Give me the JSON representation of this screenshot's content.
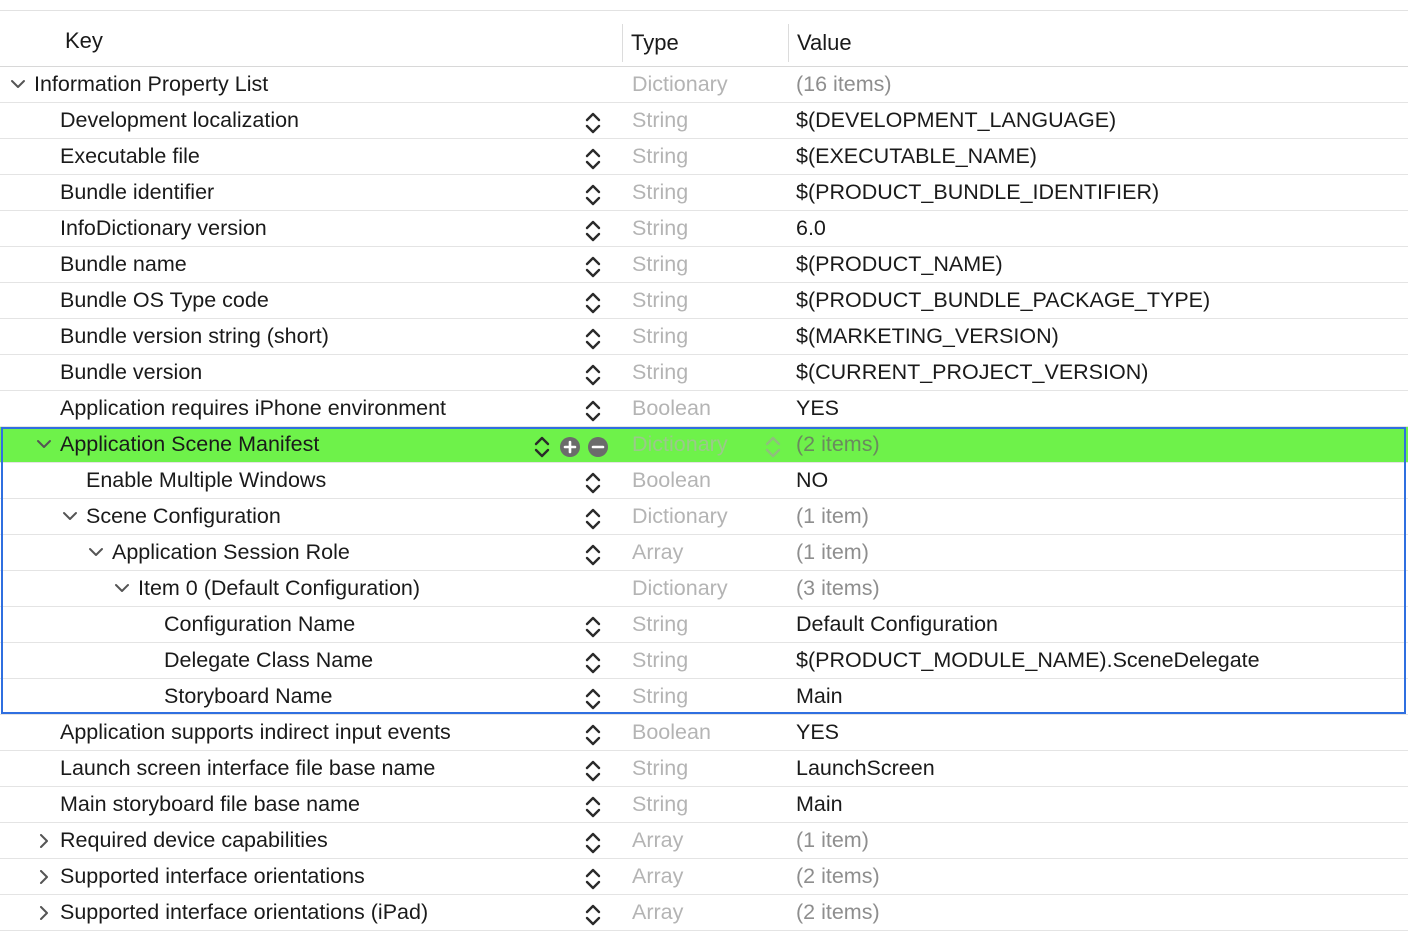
{
  "header": {
    "key": "Key",
    "type": "Type",
    "value": "Value"
  },
  "rows": [
    {
      "key": "Information Property List",
      "type": "Dictionary",
      "value": "(16 items)",
      "indent": 0,
      "disclosure": "open",
      "stepper": false,
      "value_muted": true
    },
    {
      "key": "Development localization",
      "type": "String",
      "value": "$(DEVELOPMENT_LANGUAGE)",
      "indent": 1,
      "disclosure": "none",
      "stepper": true
    },
    {
      "key": "Executable file",
      "type": "String",
      "value": "$(EXECUTABLE_NAME)",
      "indent": 1,
      "disclosure": "none",
      "stepper": true
    },
    {
      "key": "Bundle identifier",
      "type": "String",
      "value": "$(PRODUCT_BUNDLE_IDENTIFIER)",
      "indent": 1,
      "disclosure": "none",
      "stepper": true
    },
    {
      "key": "InfoDictionary version",
      "type": "String",
      "value": "6.0",
      "indent": 1,
      "disclosure": "none",
      "stepper": true
    },
    {
      "key": "Bundle name",
      "type": "String",
      "value": "$(PRODUCT_NAME)",
      "indent": 1,
      "disclosure": "none",
      "stepper": true
    },
    {
      "key": "Bundle OS Type code",
      "type": "String",
      "value": "$(PRODUCT_BUNDLE_PACKAGE_TYPE)",
      "indent": 1,
      "disclosure": "none",
      "stepper": true
    },
    {
      "key": "Bundle version string (short)",
      "type": "String",
      "value": "$(MARKETING_VERSION)",
      "indent": 1,
      "disclosure": "none",
      "stepper": true
    },
    {
      "key": "Bundle version",
      "type": "String",
      "value": "$(CURRENT_PROJECT_VERSION)",
      "indent": 1,
      "disclosure": "none",
      "stepper": true
    },
    {
      "key": "Application requires iPhone environment",
      "type": "Boolean",
      "value": "YES",
      "indent": 1,
      "disclosure": "none",
      "stepper": true
    },
    {
      "key": "Application Scene Manifest",
      "type": "Dictionary",
      "value": "(2 items)",
      "indent": 1,
      "disclosure": "open",
      "stepper": true,
      "selected": true,
      "value_muted": true
    },
    {
      "key": "Enable Multiple Windows",
      "type": "Boolean",
      "value": "NO",
      "indent": 2,
      "disclosure": "none",
      "stepper": true
    },
    {
      "key": "Scene Configuration",
      "type": "Dictionary",
      "value": "(1 item)",
      "indent": 2,
      "disclosure": "open",
      "stepper": true,
      "value_muted": true
    },
    {
      "key": "Application Session Role",
      "type": "Array",
      "value": "(1 item)",
      "indent": 3,
      "disclosure": "open",
      "stepper": true,
      "value_muted": true
    },
    {
      "key": "Item 0 (Default Configuration)",
      "type": "Dictionary",
      "value": "(3 items)",
      "indent": 4,
      "disclosure": "open",
      "stepper": false,
      "value_muted": true
    },
    {
      "key": "Configuration Name",
      "type": "String",
      "value": "Default Configuration",
      "indent": 5,
      "disclosure": "none",
      "stepper": true
    },
    {
      "key": "Delegate Class Name",
      "type": "String",
      "value": "$(PRODUCT_MODULE_NAME).SceneDelegate",
      "indent": 5,
      "disclosure": "none",
      "stepper": true
    },
    {
      "key": "Storyboard Name",
      "type": "String",
      "value": "Main",
      "indent": 5,
      "disclosure": "none",
      "stepper": true
    },
    {
      "key": "Application supports indirect input events",
      "type": "Boolean",
      "value": "YES",
      "indent": 1,
      "disclosure": "none",
      "stepper": true
    },
    {
      "key": "Launch screen interface file base name",
      "type": "String",
      "value": "LaunchScreen",
      "indent": 1,
      "disclosure": "none",
      "stepper": true
    },
    {
      "key": "Main storyboard file base name",
      "type": "String",
      "value": "Main",
      "indent": 1,
      "disclosure": "none",
      "stepper": true
    },
    {
      "key": "Required device capabilities",
      "type": "Array",
      "value": "(1 item)",
      "indent": 1,
      "disclosure": "closed",
      "stepper": true,
      "value_muted": true
    },
    {
      "key": "Supported interface orientations",
      "type": "Array",
      "value": "(2 items)",
      "indent": 1,
      "disclosure": "closed",
      "stepper": true,
      "value_muted": true
    },
    {
      "key": "Supported interface orientations (iPad)",
      "type": "Array",
      "value": "(2 items)",
      "indent": 1,
      "disclosure": "closed",
      "stepper": true,
      "value_muted": true
    }
  ],
  "colors": {
    "selection": "#6ef24a",
    "focus_border": "#2f6fe0",
    "type_text": "#b4b4b4"
  },
  "icons": {
    "disclosure_open": "chevron-down-icon",
    "disclosure_closed": "chevron-right-icon",
    "stepper": "up-down-stepper-icon",
    "add": "plus-circle-icon",
    "remove": "minus-circle-icon"
  }
}
